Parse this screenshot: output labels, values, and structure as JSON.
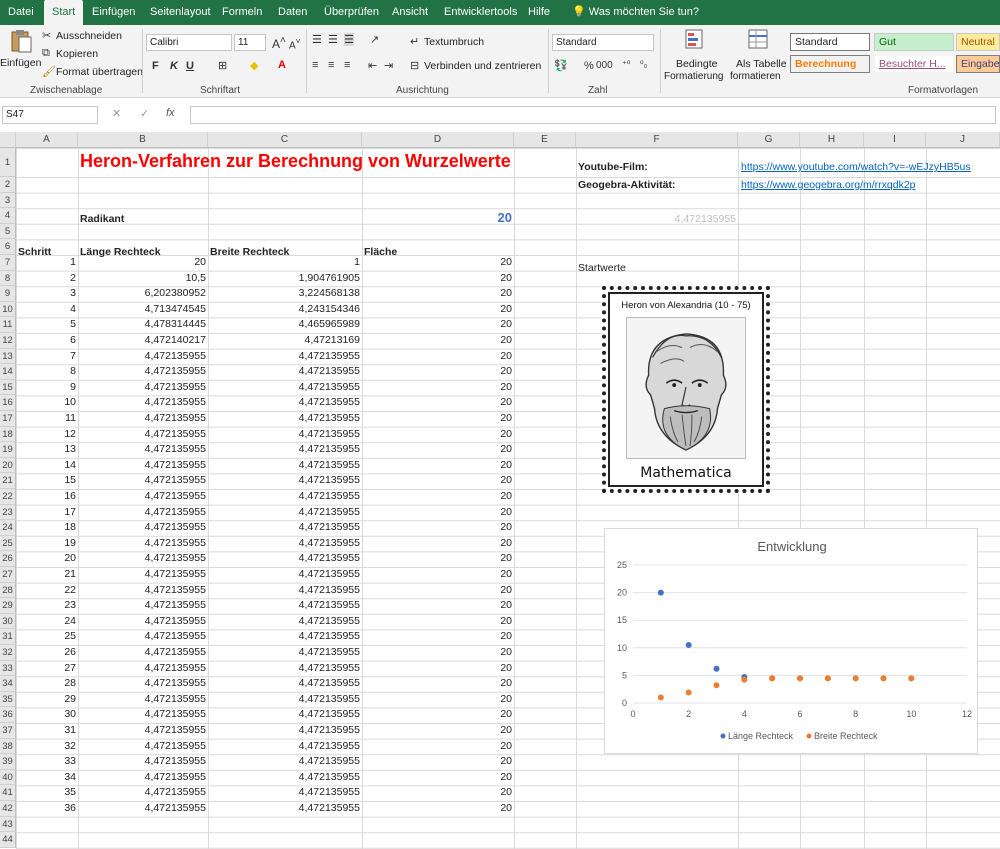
{
  "ribbon_tabs": [
    "Datei",
    "Start",
    "Einfügen",
    "Seitenlayout",
    "Formeln",
    "Daten",
    "Überprüfen",
    "Ansicht",
    "Entwicklertools",
    "Hilfe",
    "Was möchten Sie tun?"
  ],
  "ribbon": {
    "clipboard": {
      "paste": "Einfügen",
      "cut": "Ausschneiden",
      "copy": "Kopieren",
      "format_painter": "Format übertragen",
      "label": "Zwischenablage"
    },
    "font": {
      "name": "Calibri",
      "size": "11",
      "bold": "F",
      "italic": "K",
      "underline": "U",
      "label": "Schriftart"
    },
    "alignment": {
      "wrap": "Textumbruch",
      "merge": "Verbinden und zentrieren",
      "label": "Ausrichtung"
    },
    "number": {
      "format": "Standard",
      "percent": "%",
      "thousands": "000",
      "label": "Zahl"
    },
    "styles": {
      "conditional_line1": "Bedingte",
      "conditional_line2": "Formatierung",
      "table_line1": "Als Tabelle",
      "table_line2": "formatieren",
      "cells": [
        "Standard",
        "Gut",
        "Neutral",
        "Berechnung",
        "Besuchter H...",
        "Eingabe"
      ],
      "label": "Formatvorlagen"
    }
  },
  "formula_bar": {
    "name_box": "S47",
    "fx": "fx",
    "value": ""
  },
  "columns": [
    "A",
    "B",
    "C",
    "D",
    "E",
    "F",
    "G",
    "H",
    "I",
    "J"
  ],
  "rows": [
    "1",
    "2",
    "3",
    "4",
    "5",
    "6",
    "7",
    "8",
    "9",
    "10",
    "11",
    "12",
    "13",
    "14",
    "15",
    "16",
    "17",
    "18",
    "19",
    "20",
    "21",
    "22",
    "23",
    "24",
    "25",
    "26",
    "27",
    "28",
    "29",
    "30",
    "31",
    "32",
    "33",
    "34",
    "35",
    "36",
    "37",
    "38",
    "39",
    "40",
    "41",
    "42",
    "43",
    "44"
  ],
  "sheet": {
    "title": "Heron-Verfahren zur Berechnung von Wurzelwerte",
    "youtube_label": "Youtube-Film:",
    "youtube_url": "https://www.youtube.com/watch?v=-wEJzyHB5us",
    "geogebra_label": "Geogebra-Aktivität:",
    "geogebra_url": "https://www.geogebra.org/m/rrxqdk2p",
    "radikant_label": "Radikant",
    "radikant_value": "20",
    "sqrt_ref": "4,472135955",
    "startwerte": "Startwerte",
    "headers": {
      "schritt": "Schritt",
      "laenge": "Länge Rechteck",
      "breite": "Breite Rechteck",
      "flaeche": "Fläche"
    },
    "table": [
      [
        "1",
        "20",
        "1",
        "20"
      ],
      [
        "2",
        "10,5",
        "1,904761905",
        "20"
      ],
      [
        "3",
        "6,202380952",
        "3,224568138",
        "20"
      ],
      [
        "4",
        "4,713474545",
        "4,243154346",
        "20"
      ],
      [
        "5",
        "4,478314445",
        "4,465965989",
        "20"
      ],
      [
        "6",
        "4,472140217",
        "4,47213169",
        "20"
      ],
      [
        "7",
        "4,472135955",
        "4,472135955",
        "20"
      ],
      [
        "8",
        "4,472135955",
        "4,472135955",
        "20"
      ],
      [
        "9",
        "4,472135955",
        "4,472135955",
        "20"
      ],
      [
        "10",
        "4,472135955",
        "4,472135955",
        "20"
      ],
      [
        "11",
        "4,472135955",
        "4,472135955",
        "20"
      ],
      [
        "12",
        "4,472135955",
        "4,472135955",
        "20"
      ],
      [
        "13",
        "4,472135955",
        "4,472135955",
        "20"
      ],
      [
        "14",
        "4,472135955",
        "4,472135955",
        "20"
      ],
      [
        "15",
        "4,472135955",
        "4,472135955",
        "20"
      ],
      [
        "16",
        "4,472135955",
        "4,472135955",
        "20"
      ],
      [
        "17",
        "4,472135955",
        "4,472135955",
        "20"
      ],
      [
        "18",
        "4,472135955",
        "4,472135955",
        "20"
      ],
      [
        "19",
        "4,472135955",
        "4,472135955",
        "20"
      ],
      [
        "20",
        "4,472135955",
        "4,472135955",
        "20"
      ],
      [
        "21",
        "4,472135955",
        "4,472135955",
        "20"
      ],
      [
        "22",
        "4,472135955",
        "4,472135955",
        "20"
      ],
      [
        "23",
        "4,472135955",
        "4,472135955",
        "20"
      ],
      [
        "24",
        "4,472135955",
        "4,472135955",
        "20"
      ],
      [
        "25",
        "4,472135955",
        "4,472135955",
        "20"
      ],
      [
        "26",
        "4,472135955",
        "4,472135955",
        "20"
      ],
      [
        "27",
        "4,472135955",
        "4,472135955",
        "20"
      ],
      [
        "28",
        "4,472135955",
        "4,472135955",
        "20"
      ],
      [
        "29",
        "4,472135955",
        "4,472135955",
        "20"
      ],
      [
        "30",
        "4,472135955",
        "4,472135955",
        "20"
      ],
      [
        "31",
        "4,472135955",
        "4,472135955",
        "20"
      ],
      [
        "32",
        "4,472135955",
        "4,472135955",
        "20"
      ],
      [
        "33",
        "4,472135955",
        "4,472135955",
        "20"
      ],
      [
        "34",
        "4,472135955",
        "4,472135955",
        "20"
      ],
      [
        "35",
        "4,472135955",
        "4,472135955",
        "20"
      ],
      [
        "36",
        "4,472135955",
        "4,472135955",
        "20"
      ]
    ],
    "stamp": {
      "caption": "Heron von Alexandria (10 - 75)",
      "name": "Mathematica"
    }
  },
  "colors": {
    "accent": "#217346",
    "title": "#ff0000",
    "link": "#0563c1",
    "series1": "#4472c4",
    "series2": "#ed7d31"
  },
  "chart_data": {
    "type": "scatter",
    "title": "Entwicklung",
    "xlim": [
      0,
      12
    ],
    "ylim": [
      0,
      25
    ],
    "xticks": [
      0,
      2,
      4,
      6,
      8,
      10,
      12
    ],
    "yticks": [
      0,
      5,
      10,
      15,
      20,
      25
    ],
    "legend_position": "bottom",
    "series": [
      {
        "name": "Länge Rechteck",
        "color": "#4472c4",
        "x": [
          1,
          2,
          3,
          4,
          5,
          6,
          7,
          8,
          9,
          10
        ],
        "y": [
          20,
          10.5,
          6.202,
          4.713,
          4.478,
          4.472,
          4.472,
          4.472,
          4.472,
          4.472
        ]
      },
      {
        "name": "Breite Rechteck",
        "color": "#ed7d31",
        "x": [
          1,
          2,
          3,
          4,
          5,
          6,
          7,
          8,
          9,
          10
        ],
        "y": [
          1,
          1.905,
          3.225,
          4.243,
          4.466,
          4.472,
          4.472,
          4.472,
          4.472,
          4.472
        ]
      }
    ]
  }
}
